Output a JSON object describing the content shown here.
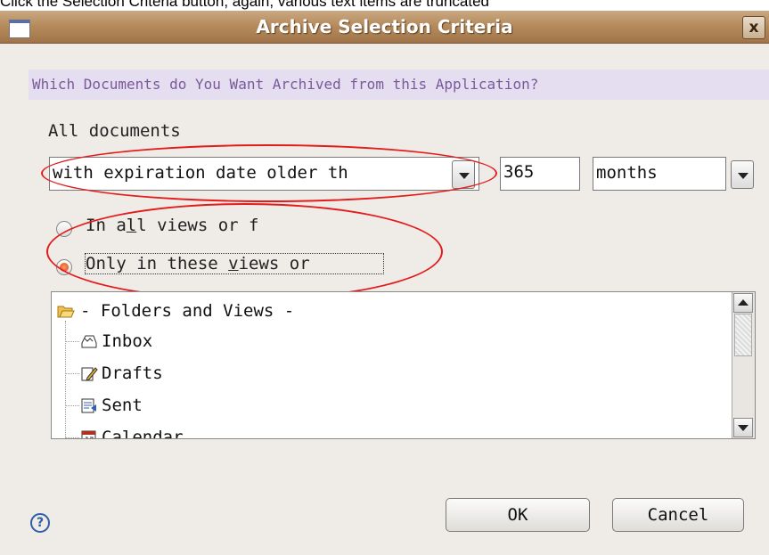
{
  "caption": "Click the Selection Criteria button, again, various text items are truncated",
  "window": {
    "title": "Archive Selection Criteria",
    "close_glyph": "x"
  },
  "question": "Which Documents do You Want Archived from this Application?",
  "scope_label": "All documents",
  "criteria": {
    "condition_value": "with expiration date older th",
    "number_value": "365",
    "unit_value": "months"
  },
  "radios": [
    {
      "label_pre": "In a",
      "label_u": "l",
      "label_post": "l views or f",
      "selected": false
    },
    {
      "label_pre": "Only in these ",
      "label_u": "v",
      "label_post": "iews or",
      "selected": true
    }
  ],
  "tree": {
    "root": "- Folders and Views -",
    "items": [
      "Inbox",
      "Drafts",
      "Sent",
      "Calendar"
    ]
  },
  "icons": [
    "folder-open-icon",
    "inbox-icon",
    "drafts-icon",
    "sent-icon",
    "calendar-icon",
    "help-icon"
  ],
  "buttons": {
    "ok": "OK",
    "cancel": "Cancel"
  },
  "colors": {
    "titlebar": "#b68c5e",
    "annotation": "#e31b1b",
    "question_bg": "#e4def0",
    "question_text": "#7a5a9a",
    "radio_selected": "#d9480f"
  }
}
